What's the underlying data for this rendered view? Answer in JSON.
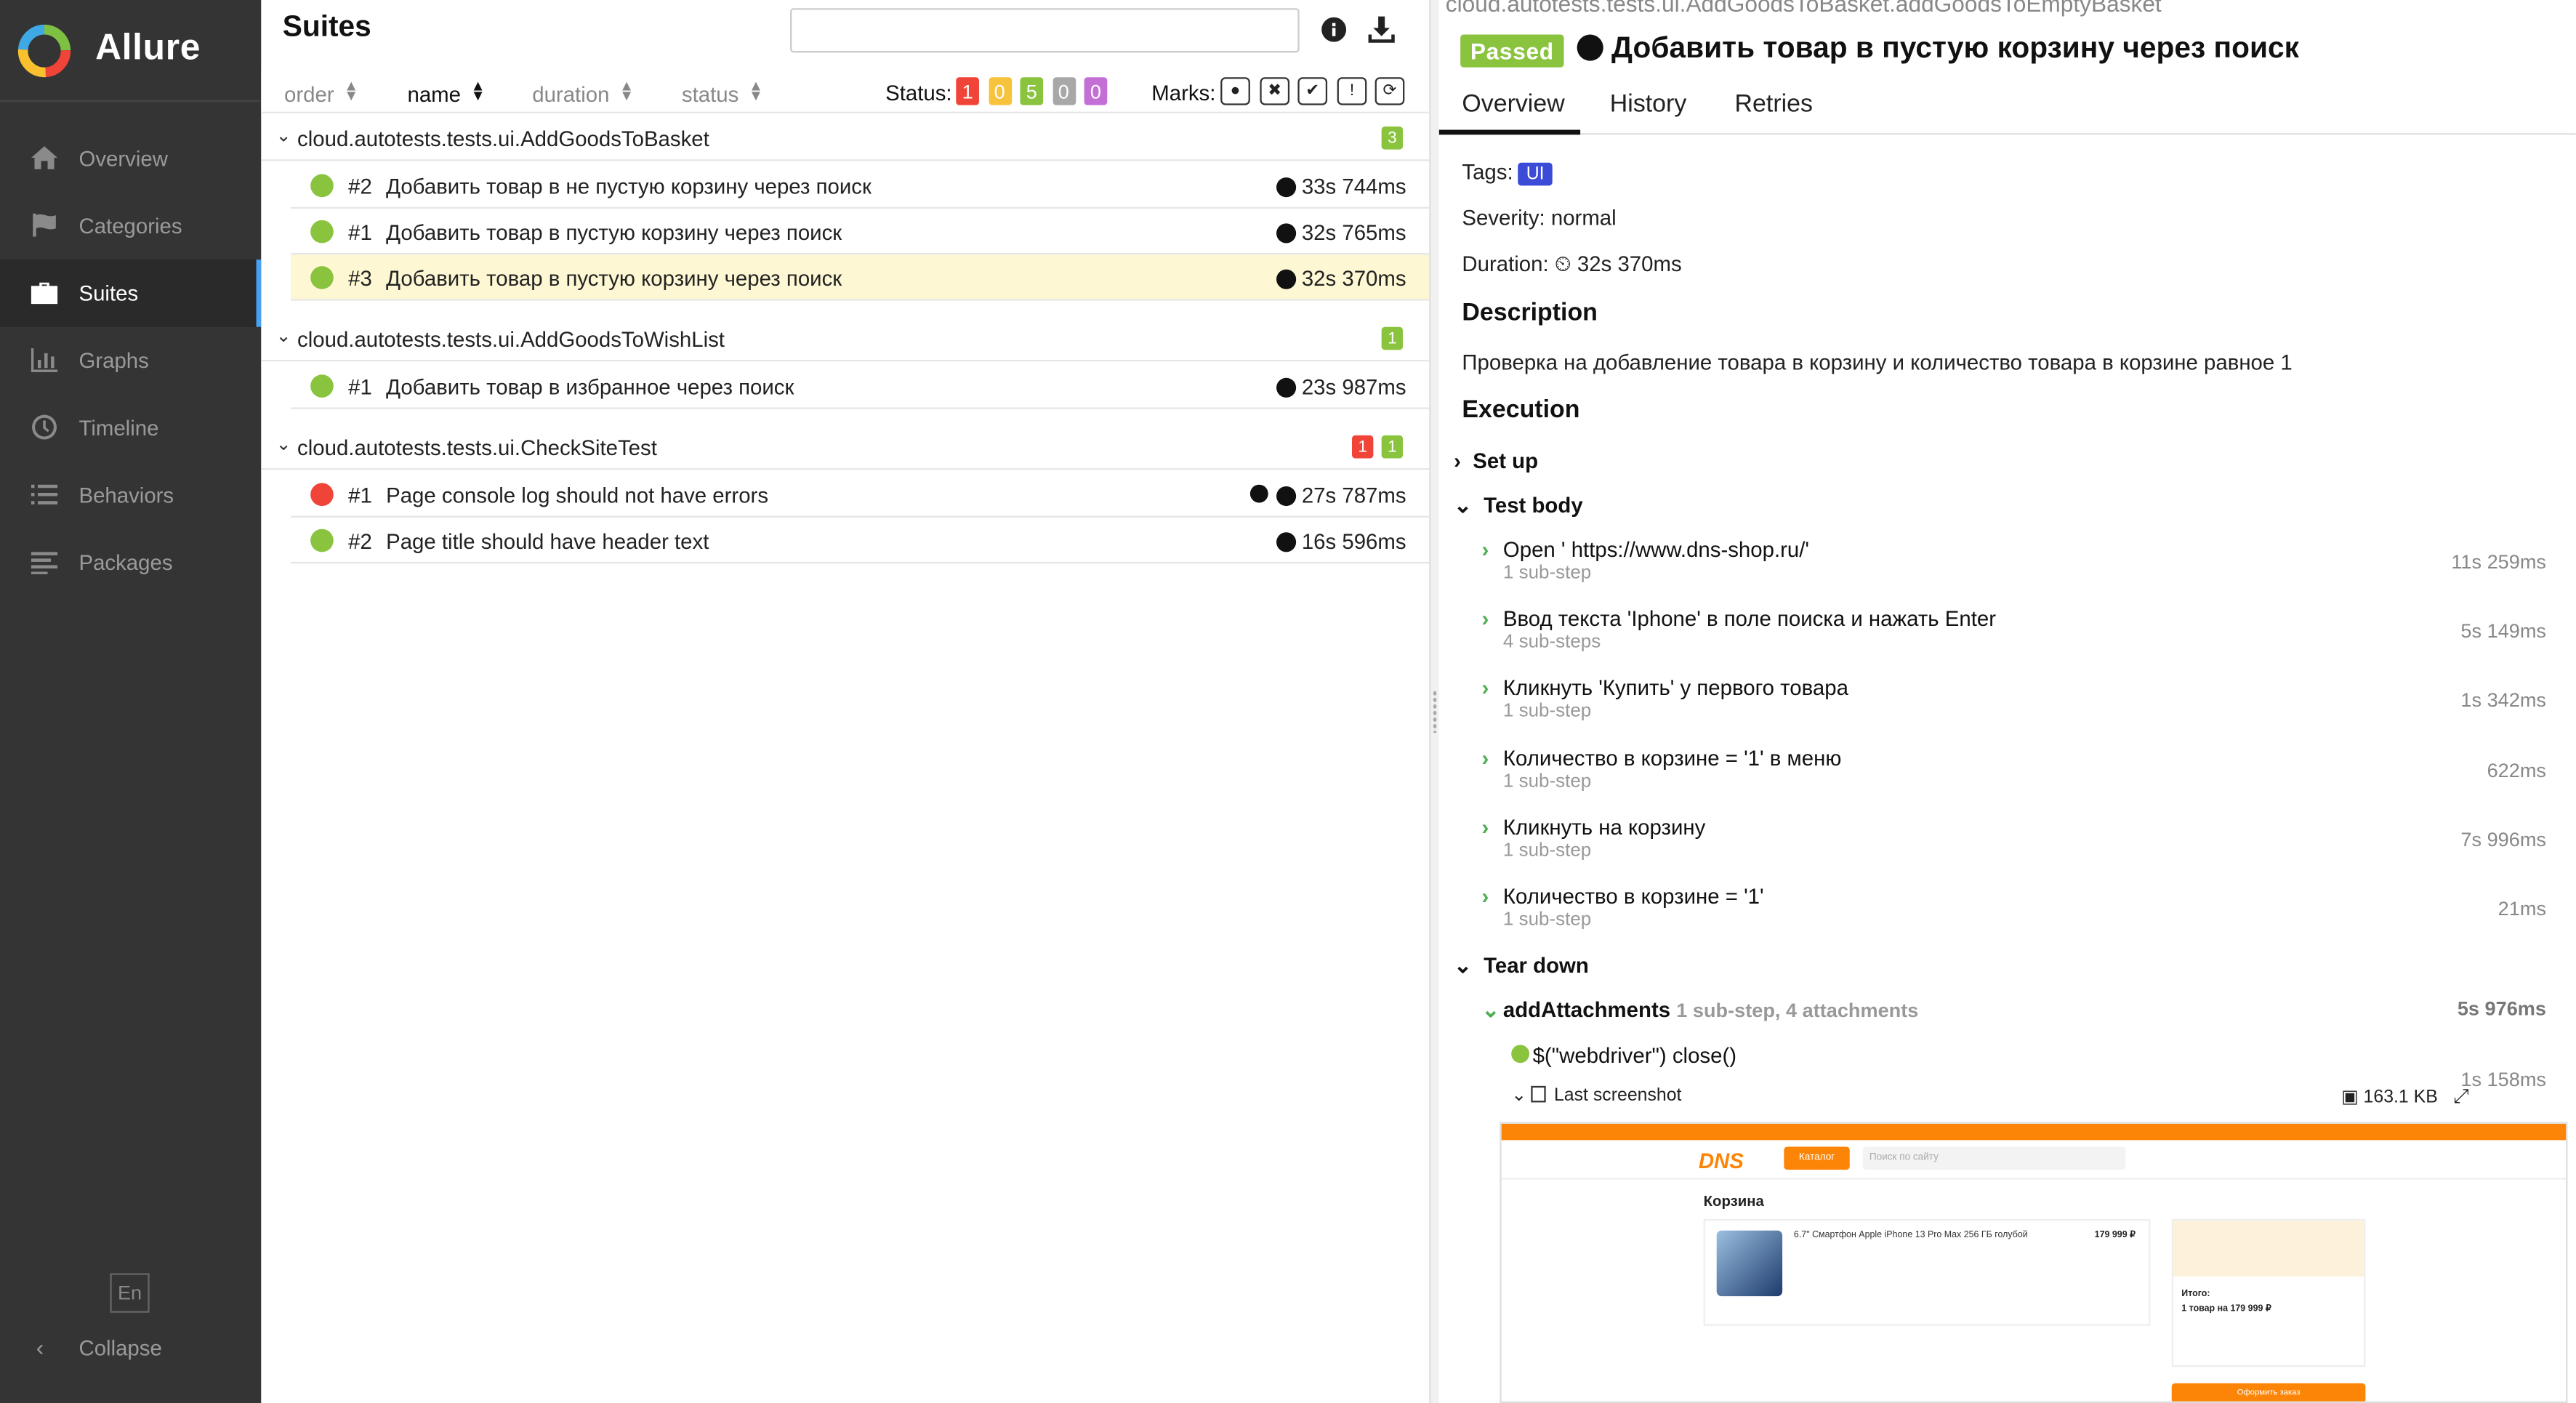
{
  "app": {
    "name": "Allure"
  },
  "sidebar": {
    "items": [
      {
        "label": "Overview",
        "icon": "home-icon"
      },
      {
        "label": "Categories",
        "icon": "flag-icon"
      },
      {
        "label": "Suites",
        "icon": "briefcase-icon",
        "active": true
      },
      {
        "label": "Graphs",
        "icon": "bar-chart-icon"
      },
      {
        "label": "Timeline",
        "icon": "clock-icon"
      },
      {
        "label": "Behaviors",
        "icon": "list-icon"
      },
      {
        "label": "Packages",
        "icon": "align-left-icon"
      }
    ],
    "lang": "En",
    "collapse": "Collapse"
  },
  "suites": {
    "title": "Suites",
    "search_value": "",
    "sort": {
      "order": "order",
      "name": "name",
      "duration": "duration",
      "status": "status"
    },
    "status_label": "Status:",
    "status_counts": [
      {
        "value": "1",
        "color": "#f04438"
      },
      {
        "value": "0",
        "color": "#f7c33d"
      },
      {
        "value": "5",
        "color": "#8ac43f"
      },
      {
        "value": "0",
        "color": "#a8a8a8"
      },
      {
        "value": "0",
        "color": "#c46fd6"
      }
    ],
    "marks_label": "Marks:",
    "groups": [
      {
        "name": "cloud.autotests.tests.ui.AddGoodsToBasket",
        "badges": [
          {
            "value": "3",
            "color": "#8ac43f"
          }
        ],
        "tests": [
          {
            "num": "#2",
            "name": "Добавить товар в не пустую корзину через поиск",
            "duration": "33s 744ms",
            "status": "passed"
          },
          {
            "num": "#1",
            "name": "Добавить товар в пустую корзину через поиск",
            "duration": "32s 765ms",
            "status": "passed"
          },
          {
            "num": "#3",
            "name": "Добавить товар в пустую корзину через поиск",
            "duration": "32s 370ms",
            "status": "passed",
            "selected": true
          }
        ]
      },
      {
        "name": "cloud.autotests.tests.ui.AddGoodsToWishList",
        "badges": [
          {
            "value": "1",
            "color": "#8ac43f"
          }
        ],
        "tests": [
          {
            "num": "#1",
            "name": "Добавить товар в избранное через поиск",
            "duration": "23s 987ms",
            "status": "passed"
          }
        ]
      },
      {
        "name": "cloud.autotests.tests.ui.CheckSiteTest",
        "badges": [
          {
            "value": "1",
            "color": "#f04438"
          },
          {
            "value": "1",
            "color": "#8ac43f"
          }
        ],
        "tests": [
          {
            "num": "#1",
            "name": "Page console log should not have errors",
            "duration": "27s 787ms",
            "status": "failed"
          },
          {
            "num": "#2",
            "name": "Page title should have header text",
            "duration": "16s 596ms",
            "status": "passed"
          }
        ]
      }
    ]
  },
  "detail": {
    "path": "cloud.autotests.tests.ui.AddGoodsToBasket.addGoodsToEmptyBasket",
    "status_badge": "Passed",
    "title": "Добавить товар в пустую корзину через поиск",
    "tabs": [
      "Overview",
      "History",
      "Retries"
    ],
    "tags_label": "Tags:",
    "tag": "UI",
    "severity": "Severity: normal",
    "duration_label": "Duration:",
    "duration": "32s 370ms",
    "description_heading": "Description",
    "description": "Проверка на добавление товара в корзину и количество товара в корзине равное 1",
    "execution_heading": "Execution",
    "setup": "Set up",
    "test_body": "Test body",
    "steps": [
      {
        "name": "Open ' https://www.dns-shop.ru/'",
        "sub": "1 sub-step",
        "duration": "11s 259ms"
      },
      {
        "name": "Ввод текста 'Iphone' в поле поиска и нажать Enter",
        "sub": "4 sub-steps",
        "duration": "5s 149ms"
      },
      {
        "name": "Кликнуть 'Купить' у первого товара",
        "sub": "1 sub-step",
        "duration": "1s 342ms"
      },
      {
        "name": "Количество в корзине = '1' в меню",
        "sub": "1 sub-step",
        "duration": "622ms"
      },
      {
        "name": "Кликнуть на корзину",
        "sub": "1 sub-step",
        "duration": "7s 996ms"
      },
      {
        "name": "Количество в корзине = '1'",
        "sub": "1 sub-step",
        "duration": "21ms"
      }
    ],
    "teardown": "Tear down",
    "attach_step": "addAttachments",
    "attach_info": "1 sub-step, 4 attachments",
    "attach_duration": "5s 976ms",
    "close_step": "$(\"webdriver\") close()",
    "close_duration": "1s 158ms",
    "screenshot_label": "Last screenshot",
    "screenshot_size": "163.1 KB",
    "screenshot": {
      "brand": "DNS",
      "catalog": "Каталог",
      "search_placeholder": "Поиск по сайту",
      "cart_heading": "Корзина",
      "product": "6.7\" Смартфон Apple iPhone 13 Pro Max 256 ГБ голубой",
      "price": "179 999 ₽",
      "total_label": "Итого:",
      "total": "1 товар на 179 999 ₽",
      "checkout": "Оформить заказ"
    }
  }
}
